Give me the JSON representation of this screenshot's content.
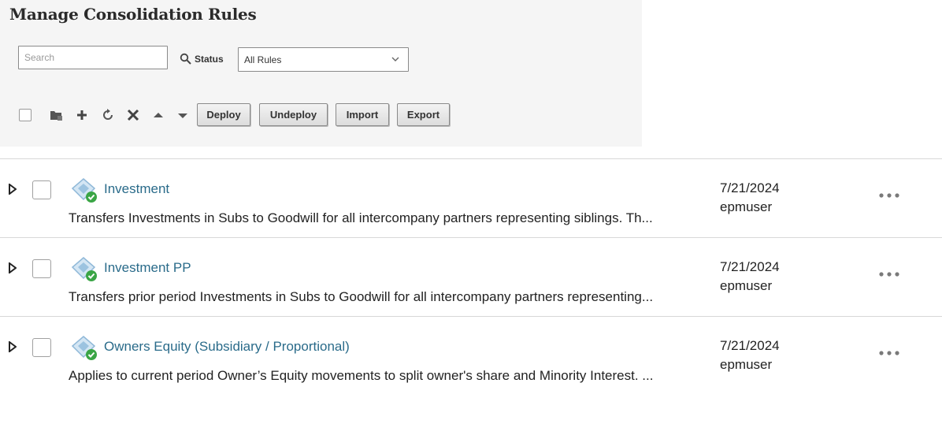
{
  "page": {
    "title": "Manage Consolidation Rules"
  },
  "filter": {
    "search_placeholder": "Search",
    "status_label": "Status",
    "status_value": "All Rules"
  },
  "toolbar": {
    "icons": [
      "select-all-checkbox",
      "folder-icon",
      "add-icon",
      "refresh-icon",
      "delete-icon",
      "move-up-icon",
      "move-down-icon"
    ],
    "buttons": {
      "deploy": "Deploy",
      "undeploy": "Undeploy",
      "import": "Import",
      "export": "Export"
    }
  },
  "colors": {
    "link": "#2a6b8a",
    "deployed_check": "#3aa545",
    "rule_icon": "#9cc3e0"
  },
  "rules": [
    {
      "name": "Investment",
      "description": "Transfers Investments in Subs to Goodwill for all intercompany partners representing siblings. Th...",
      "date": "7/21/2024",
      "user": "epmuser"
    },
    {
      "name": "Investment PP",
      "description": "Transfers prior period Investments in Subs to Goodwill for all intercompany partners representing...",
      "date": "7/21/2024",
      "user": "epmuser"
    },
    {
      "name": "Owners Equity (Subsidiary / Proportional)",
      "description": "Applies to current period Owner’s Equity movements to split owner's share and Minority Interest. ...",
      "date": "7/21/2024",
      "user": "epmuser"
    }
  ]
}
